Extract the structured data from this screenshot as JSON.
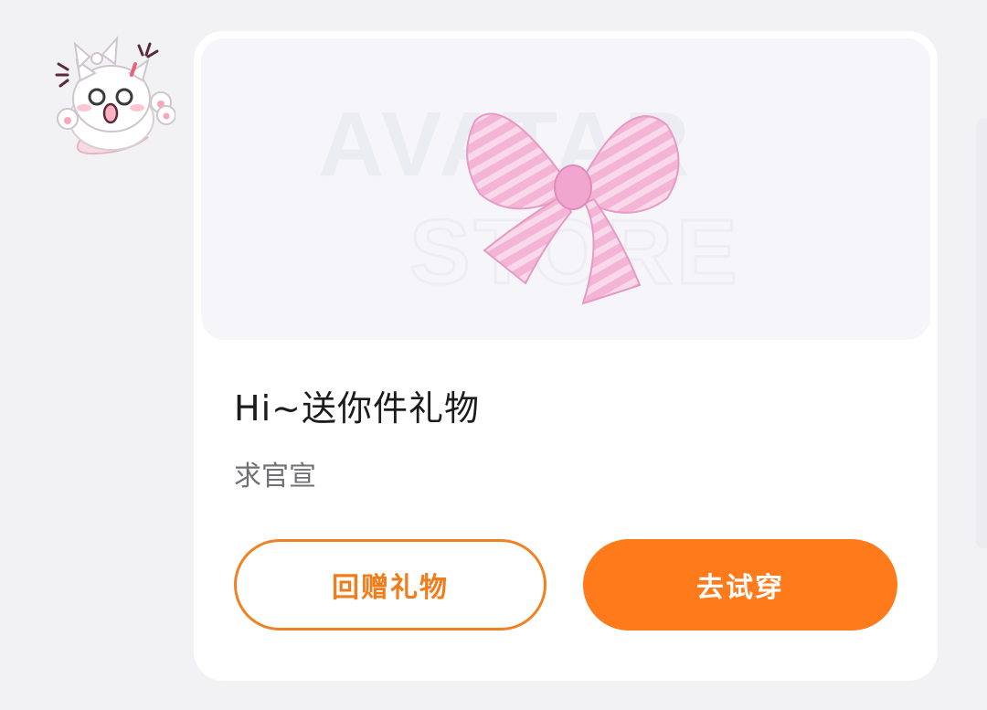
{
  "avatar": {
    "icon": "cat-bow-avatar-icon"
  },
  "card": {
    "preview": {
      "item_icon": "pink-bow-icon",
      "watermark_top": "AVATAR",
      "watermark_bottom": "STORE"
    },
    "title": "Hi~送你件礼物",
    "subtitle": "求官宣",
    "buttons": {
      "return_gift_label": "回赠礼物",
      "try_on_label": "去试穿"
    }
  },
  "colors": {
    "accent": "#ff7a1a",
    "outline": "#f08224",
    "card_bg": "#ffffff",
    "page_bg": "#f2f2f5"
  }
}
